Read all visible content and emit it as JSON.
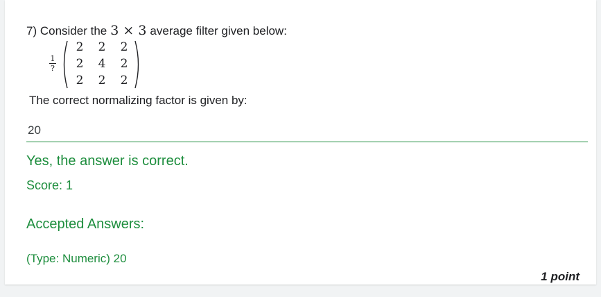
{
  "question": {
    "number_text": "7) Consider the",
    "math_expression": "3 × 3",
    "text_after": "average filter given below:",
    "fraction_numerator": "1",
    "fraction_denominator": "?",
    "matrix": [
      [
        "2",
        "2",
        "2"
      ],
      [
        "2",
        "4",
        "2"
      ],
      [
        "2",
        "2",
        "2"
      ]
    ],
    "subtext": "The correct normalizing factor is given by:"
  },
  "response": {
    "answer_value": "20"
  },
  "feedback": {
    "correct_message": "Yes, the answer is correct.",
    "score_text": "Score: 1",
    "accepted_title": "Accepted Answers:",
    "accepted_value": "(Type: Numeric) 20"
  },
  "points_text": "1 point",
  "colors": {
    "success": "#1e8e3e",
    "text": "#202124",
    "background": "#f1f3f4"
  }
}
